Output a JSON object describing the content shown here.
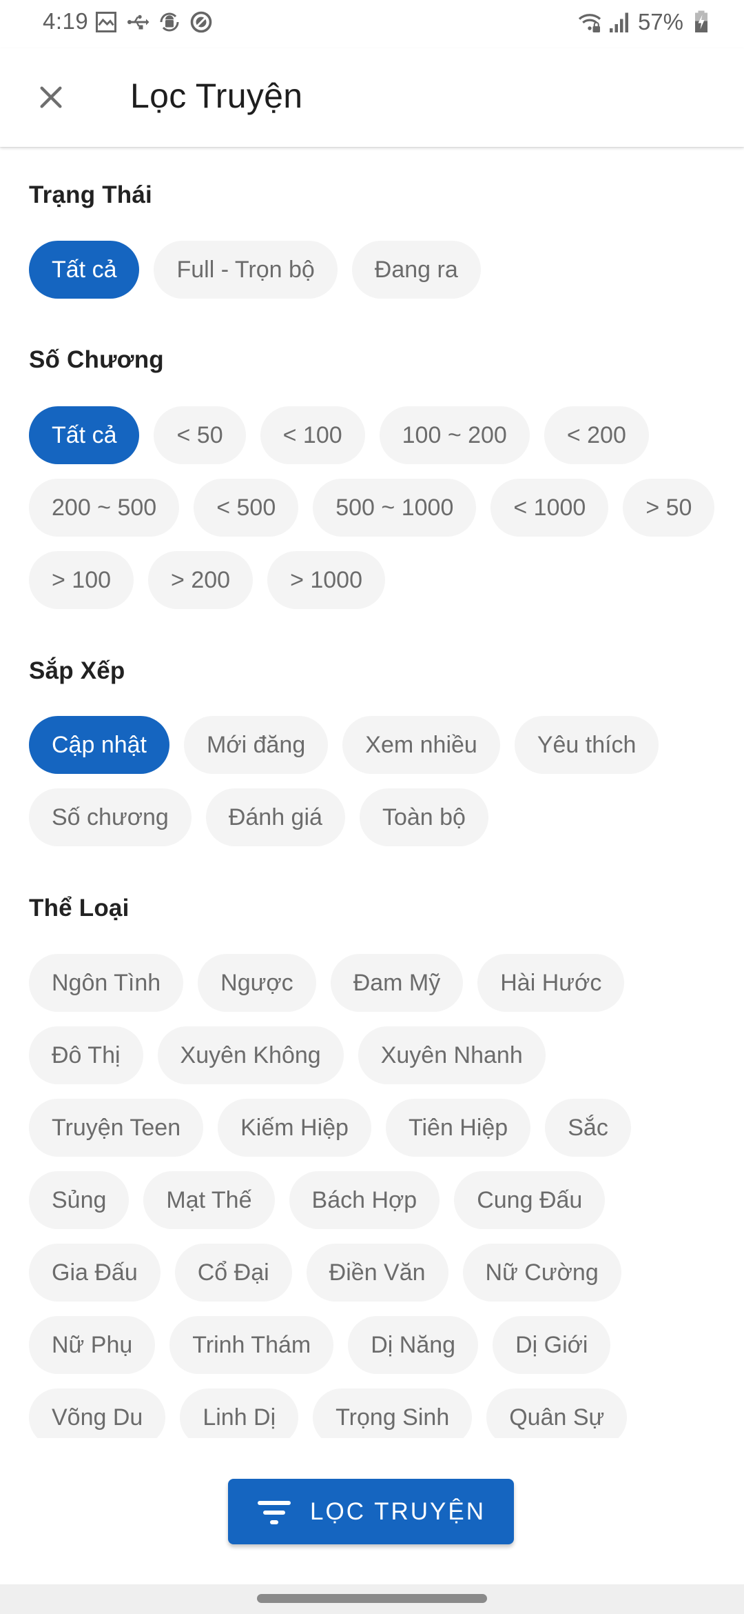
{
  "status_bar": {
    "time": "4:19",
    "battery_percent": "57%",
    "left_icons": [
      "image-icon",
      "usb-icon",
      "android-sync-icon",
      "no-disturb-icon"
    ],
    "right_icons": [
      "wifi-lock-icon",
      "signal-icon",
      "battery-charging-icon"
    ]
  },
  "toolbar": {
    "close_icon": "close-icon",
    "title": "Lọc Truyện"
  },
  "sections": {
    "status": {
      "title": "Trạng Thái",
      "selected": "Tất cả",
      "options": [
        "Tất cả",
        "Full - Trọn bộ",
        "Đang ra"
      ]
    },
    "chapters": {
      "title": "Số Chương",
      "selected": "Tất cả",
      "options": [
        "Tất cả",
        "< 50",
        "< 100",
        "100 ~ 200",
        "< 200",
        "200 ~ 500",
        "< 500",
        "500 ~ 1000",
        "< 1000",
        "> 50",
        "> 100",
        "> 200",
        "> 1000"
      ]
    },
    "sort": {
      "title": "Sắp Xếp",
      "selected": "Cập nhật",
      "options": [
        "Cập nhật",
        "Mới đăng",
        "Xem nhiều",
        "Yêu thích",
        "Số chương",
        "Đánh giá",
        "Toàn bộ"
      ]
    },
    "genre": {
      "title": "Thể Loại",
      "selected": null,
      "options": [
        "Ngôn Tình",
        "Ngược",
        "Đam Mỹ",
        "Hài Hước",
        "Đô Thị",
        "Xuyên Không",
        "Xuyên Nhanh",
        "Truyện Teen",
        "Kiếm Hiệp",
        "Tiên Hiệp",
        "Sắc",
        "Sủng",
        "Mạt Thế",
        "Bách Hợp",
        "Cung Đấu",
        "Gia Đấu",
        "Cổ Đại",
        "Điền Văn",
        "Nữ Cường",
        "Nữ Phụ",
        "Trinh Thám",
        "Dị Năng",
        "Dị Giới",
        "Võng Du",
        "Linh Dị",
        "Trọng Sinh",
        "Quân Sự"
      ]
    }
  },
  "action": {
    "icon": "filter-icon",
    "label": "LỌC TRUYỆN"
  },
  "colors": {
    "accent": "#1565C0",
    "chip_bg": "#F4F4F4",
    "chip_text": "#6B6B6B",
    "nav_bar": "#EFEFEF"
  }
}
